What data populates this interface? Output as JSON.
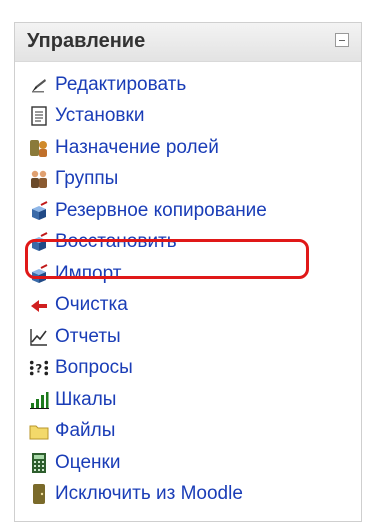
{
  "block": {
    "title": "Управление",
    "collapse_icon": "minus-box-icon"
  },
  "items": [
    {
      "label": "Редактировать",
      "icon": "edit-icon"
    },
    {
      "label": "Установки",
      "icon": "settings-document-icon"
    },
    {
      "label": "Назначение ролей",
      "icon": "assign-roles-icon"
    },
    {
      "label": "Группы",
      "icon": "groups-icon"
    },
    {
      "label": "Резервное копирование",
      "icon": "backup-icon"
    },
    {
      "label": "Восстановить",
      "icon": "restore-icon"
    },
    {
      "label": "Импорт",
      "icon": "import-icon"
    },
    {
      "label": "Очистка",
      "icon": "reset-icon"
    },
    {
      "label": "Отчеты",
      "icon": "reports-icon"
    },
    {
      "label": "Вопросы",
      "icon": "questions-icon"
    },
    {
      "label": "Шкалы",
      "icon": "scales-icon"
    },
    {
      "label": "Файлы",
      "icon": "files-folder-icon"
    },
    {
      "label": "Оценки",
      "icon": "grades-icon"
    },
    {
      "label": "Исключить из Moodle",
      "icon": "unenrol-icon"
    }
  ],
  "colors": {
    "link": "#1a3db7",
    "highlight": "#e01818"
  }
}
